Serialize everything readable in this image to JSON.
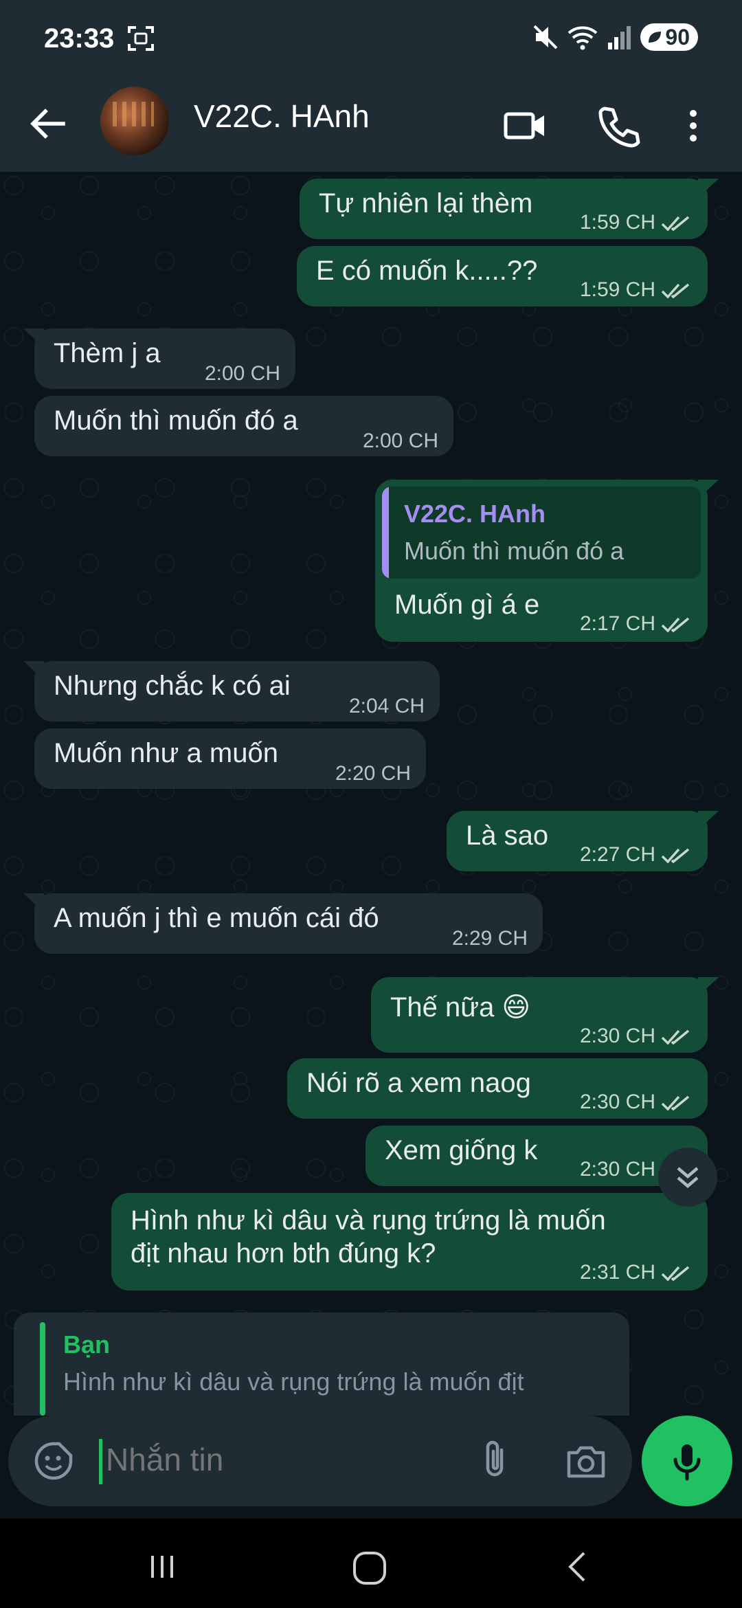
{
  "status_bar": {
    "time": "23:33",
    "battery": "90"
  },
  "header": {
    "contact_name": "V22C. HAnh"
  },
  "messages": [
    {
      "dir": "out",
      "text": "Tự nhiên lại thèm",
      "time": "1:59 CH"
    },
    {
      "dir": "out",
      "text": "E có muốn k.....??",
      "time": "1:59 CH"
    },
    {
      "dir": "in",
      "text": "Thèm j a",
      "time": "2:00 CH"
    },
    {
      "dir": "in",
      "text": "Muốn thì muốn đó a",
      "time": "2:00 CH"
    },
    {
      "dir": "out",
      "quote_name": "V22C. HAnh",
      "quote_text": "Muốn thì muốn đó a",
      "text": "Muốn gì á e",
      "time": "2:17 CH"
    },
    {
      "dir": "in",
      "text": "Nhưng chắc k có ai",
      "time": "2:04 CH"
    },
    {
      "dir": "in",
      "text": "Muốn như a muốn",
      "time": "2:20 CH"
    },
    {
      "dir": "out",
      "text": "Là sao",
      "time": "2:27 CH"
    },
    {
      "dir": "in",
      "text": "A muốn j thì e muốn cái đó",
      "time": "2:29 CH"
    },
    {
      "dir": "out",
      "text": "Thế nữa 😄",
      "time": "2:30 CH"
    },
    {
      "dir": "out",
      "text": "Nói rõ a xem naog",
      "time": "2:30 CH"
    },
    {
      "dir": "out",
      "text": "Xem giống k",
      "time": "2:30 CH"
    },
    {
      "dir": "out",
      "text_line1": "Hình như kì dâu và rụng trứng là muốn",
      "text_line2": "địt nhau hơn bth đúng k?",
      "time": "2:31 CH"
    }
  ],
  "reply_preview": {
    "name": "Bạn",
    "text": "Hình như kì dâu và rụng trứng là muốn địt"
  },
  "composer": {
    "placeholder": "Nhắn tin"
  },
  "colors": {
    "accent": "#21c063",
    "outgoing": "#144d37",
    "incoming": "#1f2c33",
    "background": "#0b141a"
  }
}
